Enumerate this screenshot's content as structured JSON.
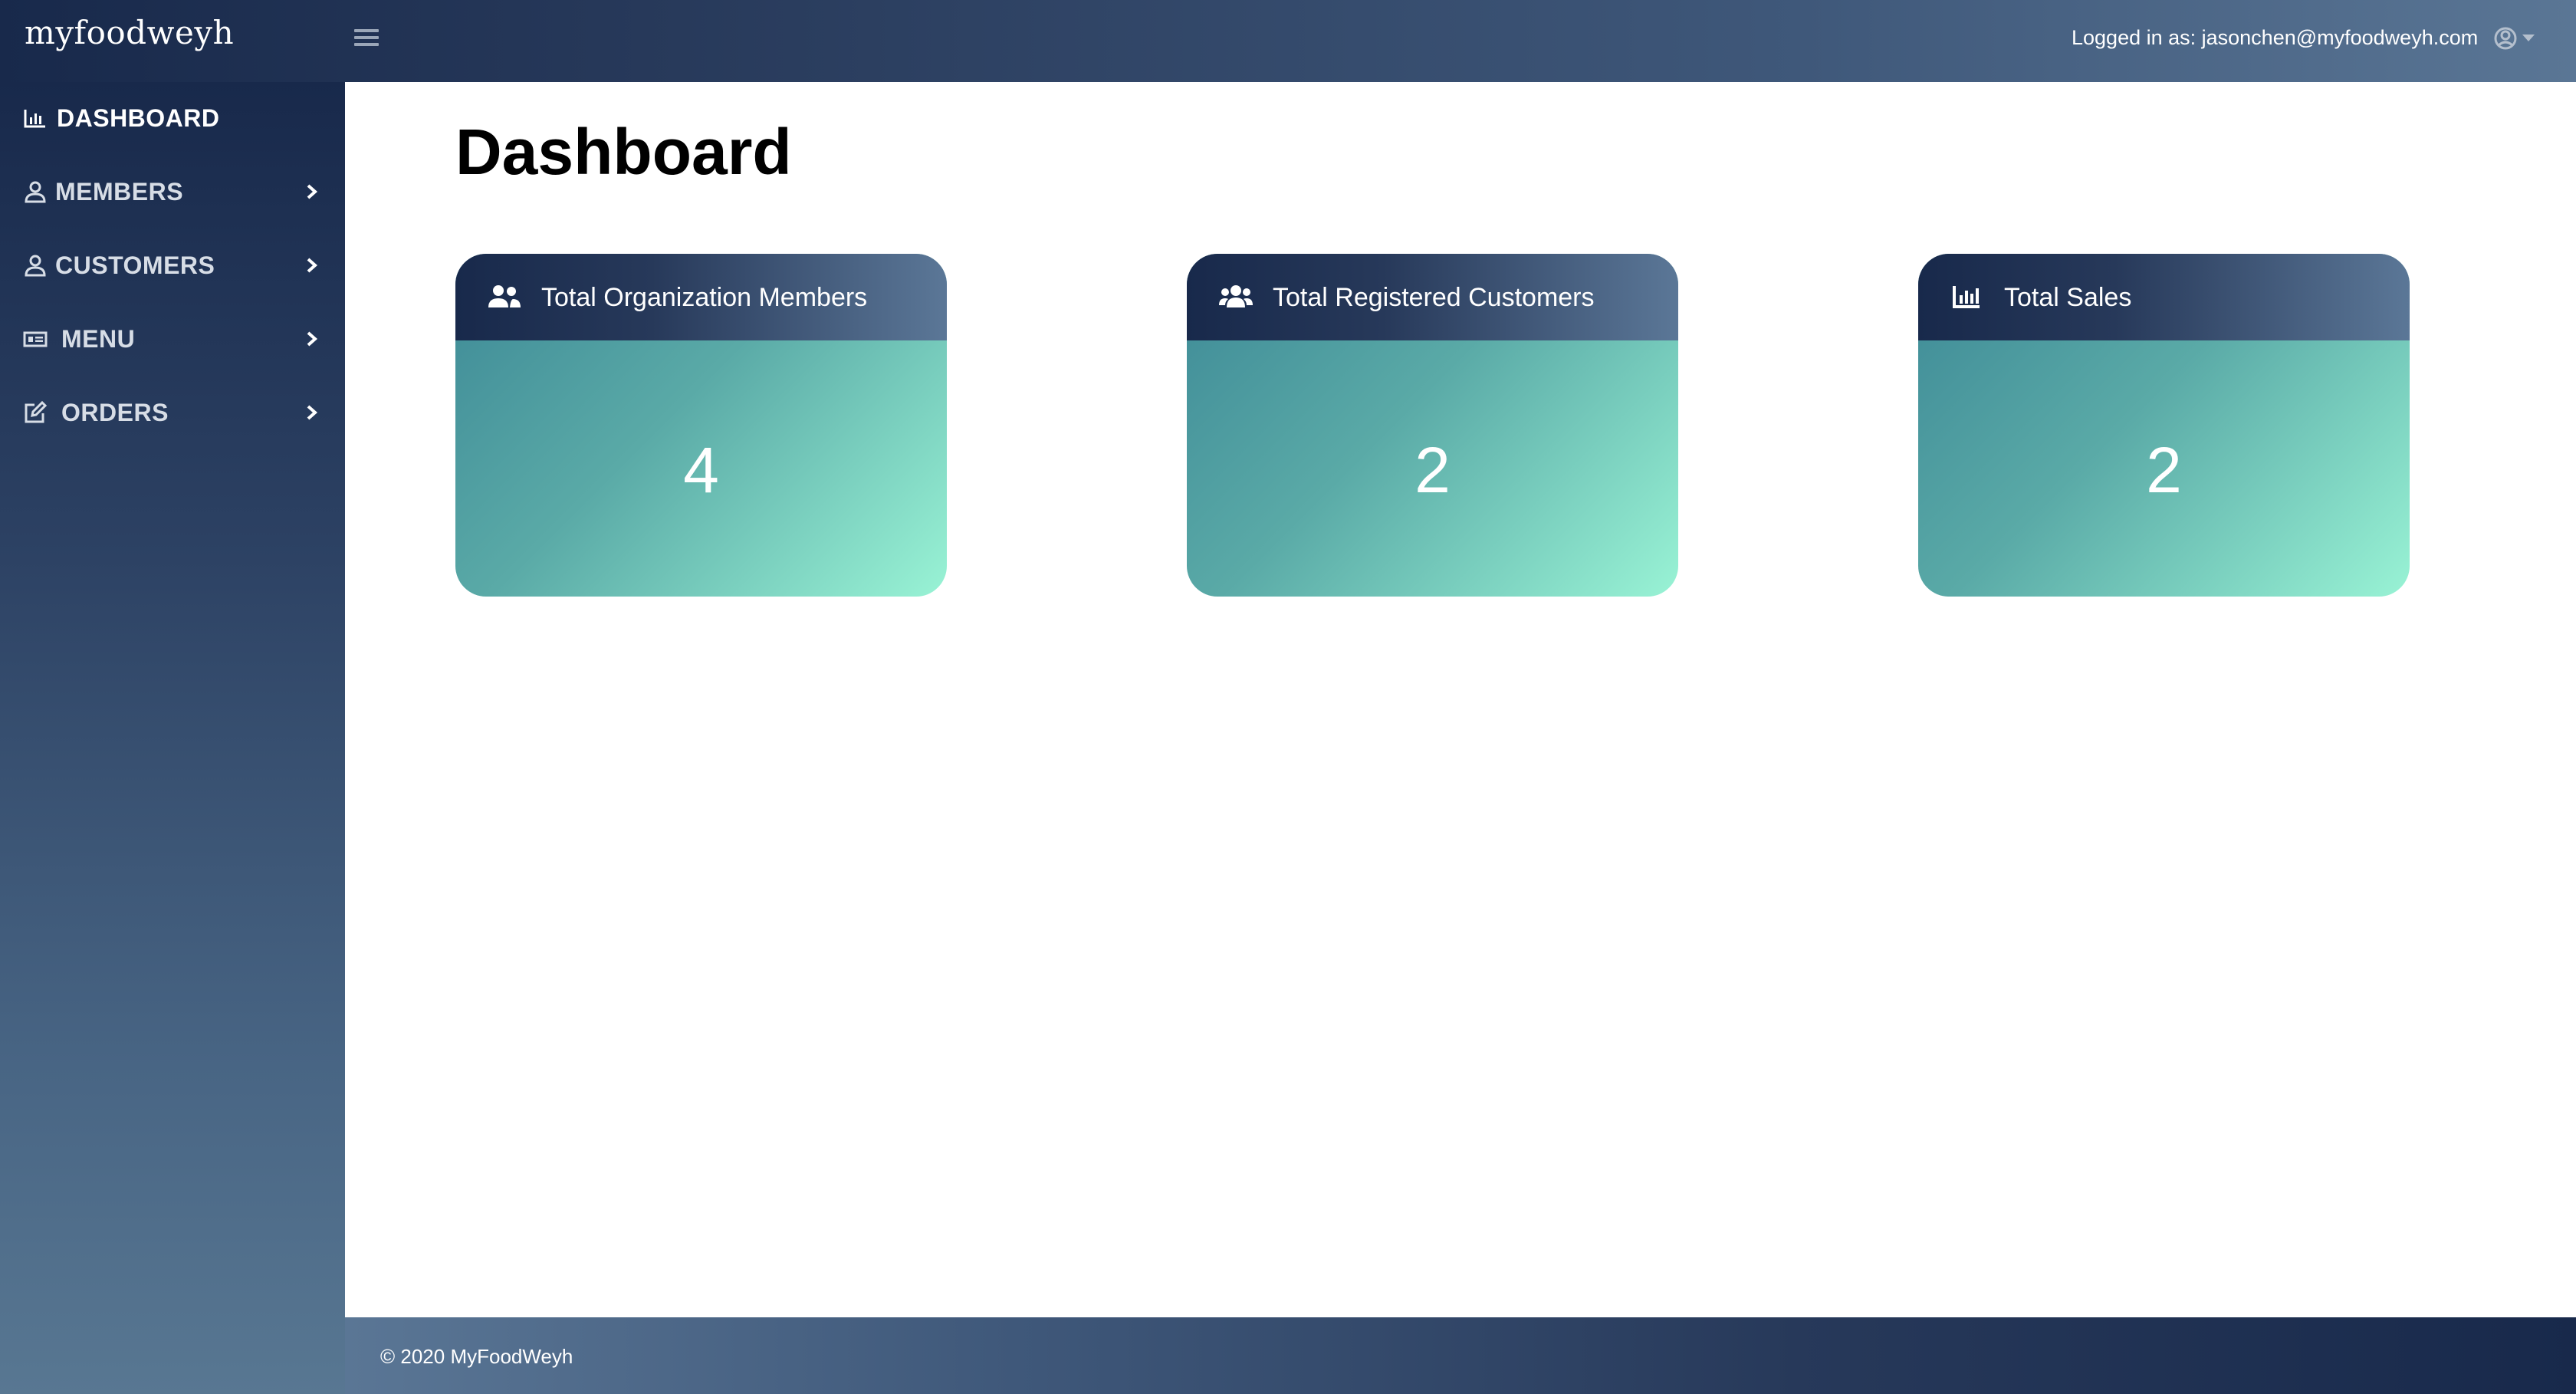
{
  "header": {
    "brand": "myfoodweyh",
    "logged_in_text": "Logged in as: jasonchen@myfoodweyh.com"
  },
  "sidebar": {
    "items": [
      {
        "label": "DASHBOARD",
        "icon": "bar-chart-icon",
        "active": true,
        "has_chevron": false
      },
      {
        "label": "MEMBERS",
        "icon": "user-icon",
        "active": false,
        "has_chevron": true
      },
      {
        "label": "CUSTOMERS",
        "icon": "user-icon",
        "active": false,
        "has_chevron": true
      },
      {
        "label": "MENU",
        "icon": "menu-card-icon",
        "active": false,
        "has_chevron": true
      },
      {
        "label": "ORDERS",
        "icon": "edit-icon",
        "active": false,
        "has_chevron": true
      }
    ]
  },
  "main": {
    "title": "Dashboard",
    "cards": [
      {
        "title": "Total Organization Members",
        "value": "4",
        "icon": "users-icon"
      },
      {
        "title": "Total Registered Customers",
        "value": "2",
        "icon": "users-group-icon"
      },
      {
        "title": "Total Sales",
        "value": "2",
        "icon": "bar-chart-icon"
      }
    ]
  },
  "footer": {
    "text": "© 2020 MyFoodWeyh"
  },
  "colors": {
    "nav_dark": "#18294b",
    "nav_light": "#5a7695",
    "card_teal": "#3d8996",
    "card_mint": "#99f3d5"
  }
}
